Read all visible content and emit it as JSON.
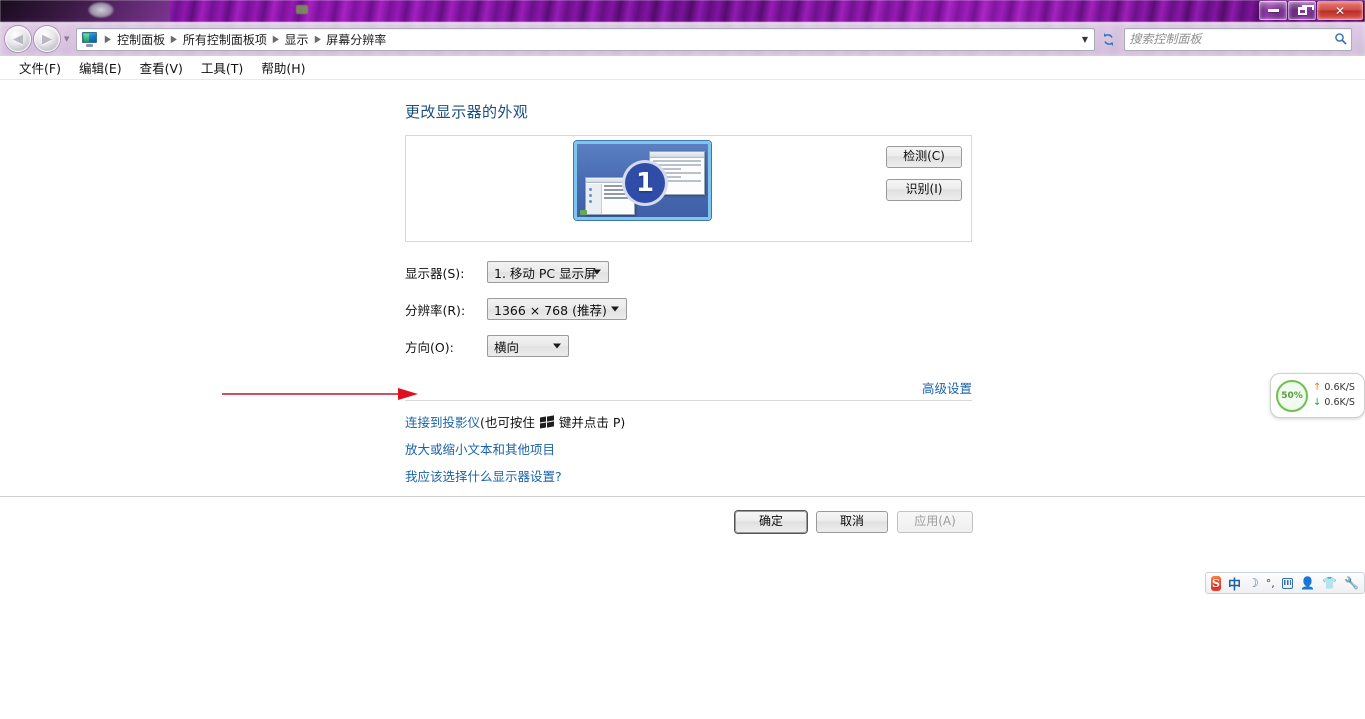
{
  "window": {
    "controls": {
      "minimize": "minimize",
      "restore": "restore",
      "close": "close"
    }
  },
  "nav": {
    "back_label": "◀",
    "forward_label": "▶",
    "recent_dropdown": "▼",
    "address_icon": "display-icon",
    "breadcrumbs": [
      "控制面板",
      "所有控制面板项",
      "显示",
      "屏幕分辨率"
    ],
    "address_dropdown": "▼",
    "refresh_label": "refresh-icon",
    "search": {
      "placeholder": "搜索控制面板",
      "value": "",
      "icon": "search-icon"
    }
  },
  "menubar": {
    "items": [
      "文件(F)",
      "编辑(E)",
      "查看(V)",
      "工具(T)",
      "帮助(H)"
    ]
  },
  "page": {
    "title": "更改显示器的外观",
    "preview": {
      "monitor_number": "1",
      "detect_button": "检测(C)",
      "identify_button": "识别(I)"
    },
    "fields": [
      {
        "label": "显示器(S):",
        "value": "1. 移动 PC 显示屏"
      },
      {
        "label": "分辨率(R):",
        "value": "1366 × 768 (推荐)"
      },
      {
        "label": "方向(O):",
        "value": "横向"
      }
    ],
    "advanced_link": "高级设置",
    "links": [
      {
        "link_text": "连接到投影仪",
        "suffix_before_key": " (也可按住 ",
        "key_icon": "windows-logo-key",
        "suffix_after_key": " 键并点击 P)"
      },
      {
        "link_text": "放大或缩小文本和其他项目",
        "suffix_before_key": "",
        "key_icon": "",
        "suffix_after_key": ""
      },
      {
        "link_text": "我应该选择什么显示器设置?",
        "suffix_before_key": "",
        "key_icon": "",
        "suffix_after_key": ""
      }
    ],
    "footer_buttons": {
      "ok": "确定",
      "cancel": "取消",
      "apply": "应用(A)"
    }
  },
  "annotation": {
    "arrow_color": "#c0162c",
    "points_to": "分辨率(R):"
  },
  "net_widget": {
    "percent": "50%",
    "upload": "0.6K/S",
    "download": "0.6K/S",
    "ring_color": "#6fc04e"
  },
  "ime_tray": {
    "logo": "S",
    "mode": "中",
    "items": [
      "moon-icon",
      "degree-icon",
      "keyboard-icon",
      "person-icon",
      "shirt-icon",
      "wrench-icon"
    ]
  }
}
